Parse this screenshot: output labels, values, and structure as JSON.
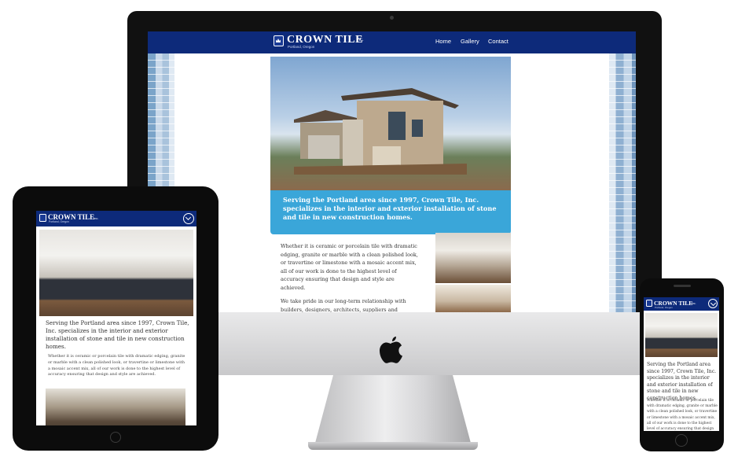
{
  "brand": {
    "name": "CROWN TILE",
    "suffix": "Inc.",
    "location": "Portland, Oregon"
  },
  "nav": {
    "items": [
      "Home",
      "Gallery",
      "Contact"
    ]
  },
  "content": {
    "headline": "Serving the Portland area since 1997, Crown Tile, Inc. specializes in the interior and exterior installation of stone and tile in new construction homes.",
    "paragraph1": "Whether it is ceramic or porcelain tile with dramatic edging, granite or marble with a clean polished look, or travertine or limestone with a mosaic accent mix, all of our work is done to the highest level of accuracy ensuring that design and style are achieved.",
    "paragraph2": "We take pride in our long-term relationship with builders, designers, architects, suppliers and"
  },
  "icons": {
    "menu_toggle": "chevron-down-circle-icon",
    "logo": "crown-icon",
    "apple": "apple-logo-icon"
  },
  "colors": {
    "nav": "#0d2a7a",
    "caption": "#3aa6d9",
    "device": "#0c0c0c"
  }
}
